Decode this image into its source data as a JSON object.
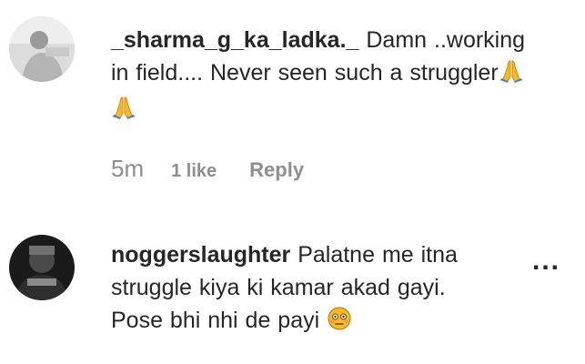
{
  "comments": [
    {
      "username": "_sharma_g_ka_ladka._",
      "text": "Damn ..working in field.... Never seen such a struggler",
      "emoji_icons": [
        "folded-hands-icon",
        "folded-hands-icon"
      ],
      "time": "5m",
      "likes": "1 like",
      "reply_label": "Reply"
    },
    {
      "username": "noggerslaughter",
      "text_line1": "Palatne me itna",
      "text_line2": "struggle kiya ki kamar akad gayi.",
      "text_line3": "Pose bhi nhi de payi",
      "emoji_icon": "flushed-face-icon",
      "more_label": "..."
    }
  ],
  "colors": {
    "text": "#262626",
    "meta": "#8e8e8e",
    "emoji_yellow": "#f7b928"
  }
}
